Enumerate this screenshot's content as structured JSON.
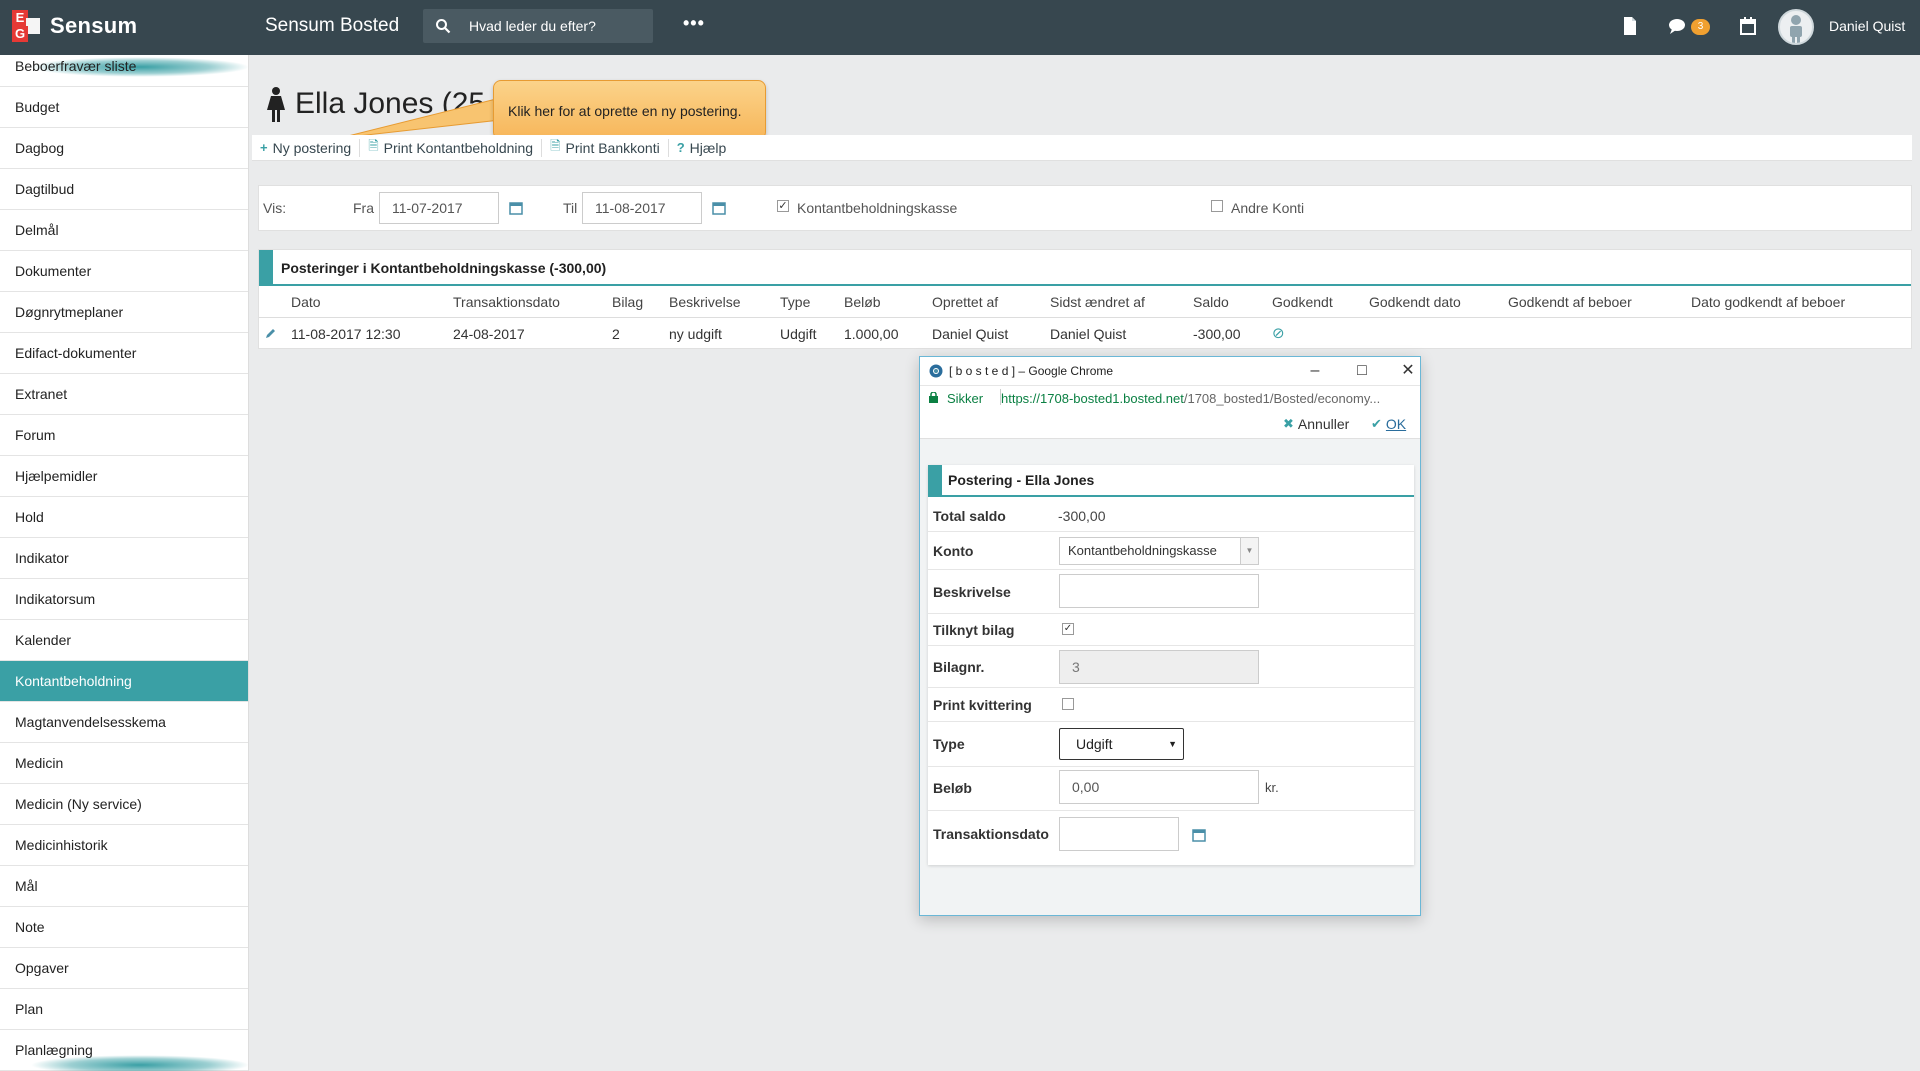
{
  "header": {
    "brand": "Sensum",
    "logo_letters": [
      "E",
      "G"
    ],
    "app_title": "Sensum Bosted",
    "search_placeholder": "Hvad leder du efter?",
    "more": "•••",
    "notification_count": "3",
    "user_name": "Daniel Quist",
    "icons": [
      "search-icon",
      "more-icon",
      "document-icon",
      "chat-icon",
      "calendar-icon",
      "avatar"
    ]
  },
  "sidebar": {
    "items": [
      {
        "label": "Beboerfravær sliste"
      },
      {
        "label": "Budget"
      },
      {
        "label": "Dagbog"
      },
      {
        "label": "Dagtilbud"
      },
      {
        "label": "Delmål"
      },
      {
        "label": "Dokumenter"
      },
      {
        "label": "Døgnrytmeplaner"
      },
      {
        "label": "Edifact-dokumenter"
      },
      {
        "label": "Extranet"
      },
      {
        "label": "Forum"
      },
      {
        "label": "Hjælpemidler"
      },
      {
        "label": "Hold"
      },
      {
        "label": "Indikator"
      },
      {
        "label": "Indikatorsum"
      },
      {
        "label": "Kalender"
      },
      {
        "label": "Kontantbeholdning"
      },
      {
        "label": "Magtanvendelsesskema"
      },
      {
        "label": "Medicin"
      },
      {
        "label": "Medicin (Ny service)"
      },
      {
        "label": "Medicinhistorik"
      },
      {
        "label": "Mål"
      },
      {
        "label": "Note"
      },
      {
        "label": "Opgaver"
      },
      {
        "label": "Plan"
      },
      {
        "label": "Planlægning"
      }
    ],
    "active": "Kontantbeholdning"
  },
  "page": {
    "person_name": "Ella Jones (25",
    "tooltip": "Klik her for at oprette en ny postering.",
    "toolbar": [
      {
        "label": "Ny postering",
        "icon": "+"
      },
      {
        "label": "Print Kontantbeholdning",
        "icon": "pdf-icon"
      },
      {
        "label": "Print Bankkonti",
        "icon": "pdf-icon"
      },
      {
        "label": "Hjælp",
        "icon": "?"
      }
    ]
  },
  "filter": {
    "vis_label": "Vis:",
    "fra_label": "Fra",
    "fra_value": "11-07-2017",
    "til_label": "Til",
    "til_value": "11-08-2017",
    "kasse_label": "Kontantbeholdningskasse",
    "kasse_checked": true,
    "andre_label": "Andre Konti",
    "andre_checked": false
  },
  "table": {
    "title": "Posteringer i Kontantbeholdningskasse (-300,00)",
    "columns": [
      "Dato",
      "Transaktionsdato",
      "Bilag",
      "Beskrivelse",
      "Type",
      "Beløb",
      "Oprettet af",
      "Sidst ændret af",
      "Saldo",
      "Godkendt",
      "Godkendt dato",
      "Godkendt af beboer",
      "Dato godkendt af beboer"
    ],
    "rows": [
      {
        "dato": "11-08-2017 12:30",
        "transaktionsdato": "24-08-2017",
        "bilag": "2",
        "beskrivelse": "ny udgift",
        "type": "Udgift",
        "beloeb": "1.000,00",
        "oprettet_af": "Daniel Quist",
        "sidst_aendret_af": "Daniel Quist",
        "saldo": "-300,00",
        "godkendt": "⊘"
      }
    ]
  },
  "dialog": {
    "window_title": "[ b o s t e d ] – Google Chrome",
    "secure_label": "Sikker",
    "url_main": "https://1708-bosted1.bosted.net",
    "url_rest": "/1708_bosted1/Bosted/economy...",
    "annuller": "Annuller",
    "ok": "OK",
    "form_title": "Postering - Ella Jones",
    "total_saldo_label": "Total saldo",
    "total_saldo_value": "-300,00",
    "konto_label": "Konto",
    "konto_value": "Kontantbeholdningskasse",
    "beskrivelse_label": "Beskrivelse",
    "beskrivelse_value": "",
    "tilknyt_label": "Tilknyt bilag",
    "tilknyt_checked": true,
    "bilagnr_label": "Bilagnr.",
    "bilagnr_value": "3",
    "print_label": "Print kvittering",
    "print_checked": false,
    "type_label": "Type",
    "type_value": "Udgift",
    "beloeb_label": "Beløb",
    "beloeb_value": "0,00",
    "beloeb_unit": "kr.",
    "transaktionsdato_label": "Transaktionsdato",
    "transaktionsdato_value": ""
  },
  "colors": {
    "topbar": "#37474f",
    "accent": "#3aa0a5",
    "badge": "#f0a030",
    "tooltip": "#f7b65a"
  }
}
